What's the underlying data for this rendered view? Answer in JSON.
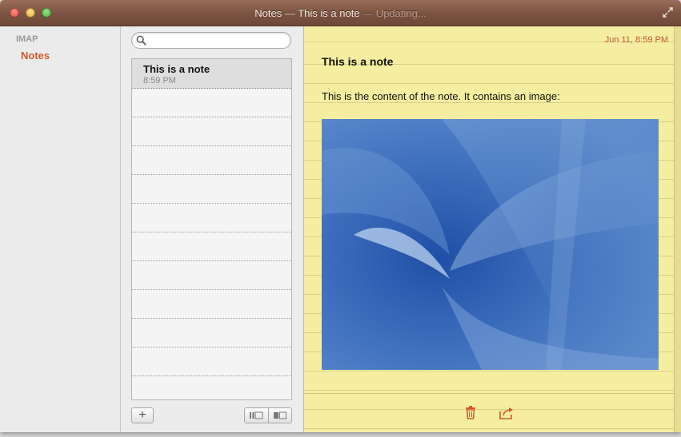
{
  "window": {
    "title": "Notes — This is a note",
    "status": "— Updating..."
  },
  "sidebar": {
    "account": "IMAP",
    "folder": "Notes"
  },
  "search": {
    "placeholder": ""
  },
  "notes_list": [
    {
      "title": "This is a note",
      "time": "8:59 PM"
    }
  ],
  "toolbar": {
    "add_label": "+"
  },
  "note": {
    "date": "Jun 11, 8:59 PM",
    "title": "This is a note",
    "body": "This is the content of the note. It contains an image:"
  },
  "colors": {
    "titlebar": "#7d5443",
    "accent": "#d05a30",
    "note_paper": "#f5eea0",
    "image_blue": "#3e6fbd"
  },
  "icons": [
    "search-icon",
    "trash-icon",
    "share-icon",
    "fullscreen-icon",
    "list-view-icon",
    "gallery-view-icon"
  ]
}
